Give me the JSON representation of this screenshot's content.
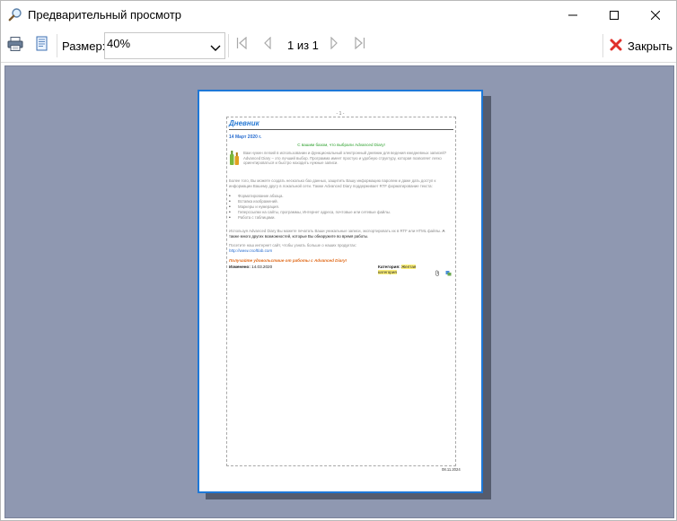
{
  "window": {
    "title": "Предварительный просмотр"
  },
  "toolbar": {
    "size_label": "Размер:",
    "zoom_value": "40%",
    "page_indicator": "1 из 1",
    "close_label": "Закрыть"
  },
  "document": {
    "page_number": "- 1 -",
    "title": "Дневник",
    "date": "14 Март 2020 г.",
    "heading": "С вашим базом, что выбрали Advanced Diary!",
    "paragraph1": "Вам нужен легкий в использовании и функциональный электронный дневник для ведения ежедневных записей? Advanced Diary – это лучший выбор. Программа имеет простую и удобную структуру, которая позволяет легко ориентироваться и быстро находить нужные записи.",
    "paragraph2": "Более того, Вы можете создать несколько баз данных, защитить Вашу информацию паролем и даже дать доступ к информации Вашему другу в локальной сети. Также Advanced Diary поддерживает RTF форматирование текста:",
    "list": [
      "Форматирование абзаца.",
      "Вставка изображений.",
      "Маркеры и нумерация.",
      "Гиперссылки на сайты, программы, Интернет адреса, почтовые или сетевые файлы.",
      "Работа с таблицами."
    ],
    "paragraph3_gray": "Используя Advanced Diary Вы можете печатать Ваши уникальные записи, экспортировать их в RTF или HTML файлы.",
    "paragraph3_dark": "А также много других возможностей, которые Вы обнаружите во время работы.",
    "paragraph4": "Посетите наш интернет сайт, чтобы узнать больше о наших продуктах:",
    "link": "http://www.csoftlab.com",
    "promo": "Получайте удовольствие от работы с Advanced Diary!",
    "modified_label": "Изменено:",
    "modified_value": "14.03.2020",
    "category_label": "Категория:",
    "category_value": "Желтая категория",
    "footer_date": "08.11.2024"
  }
}
